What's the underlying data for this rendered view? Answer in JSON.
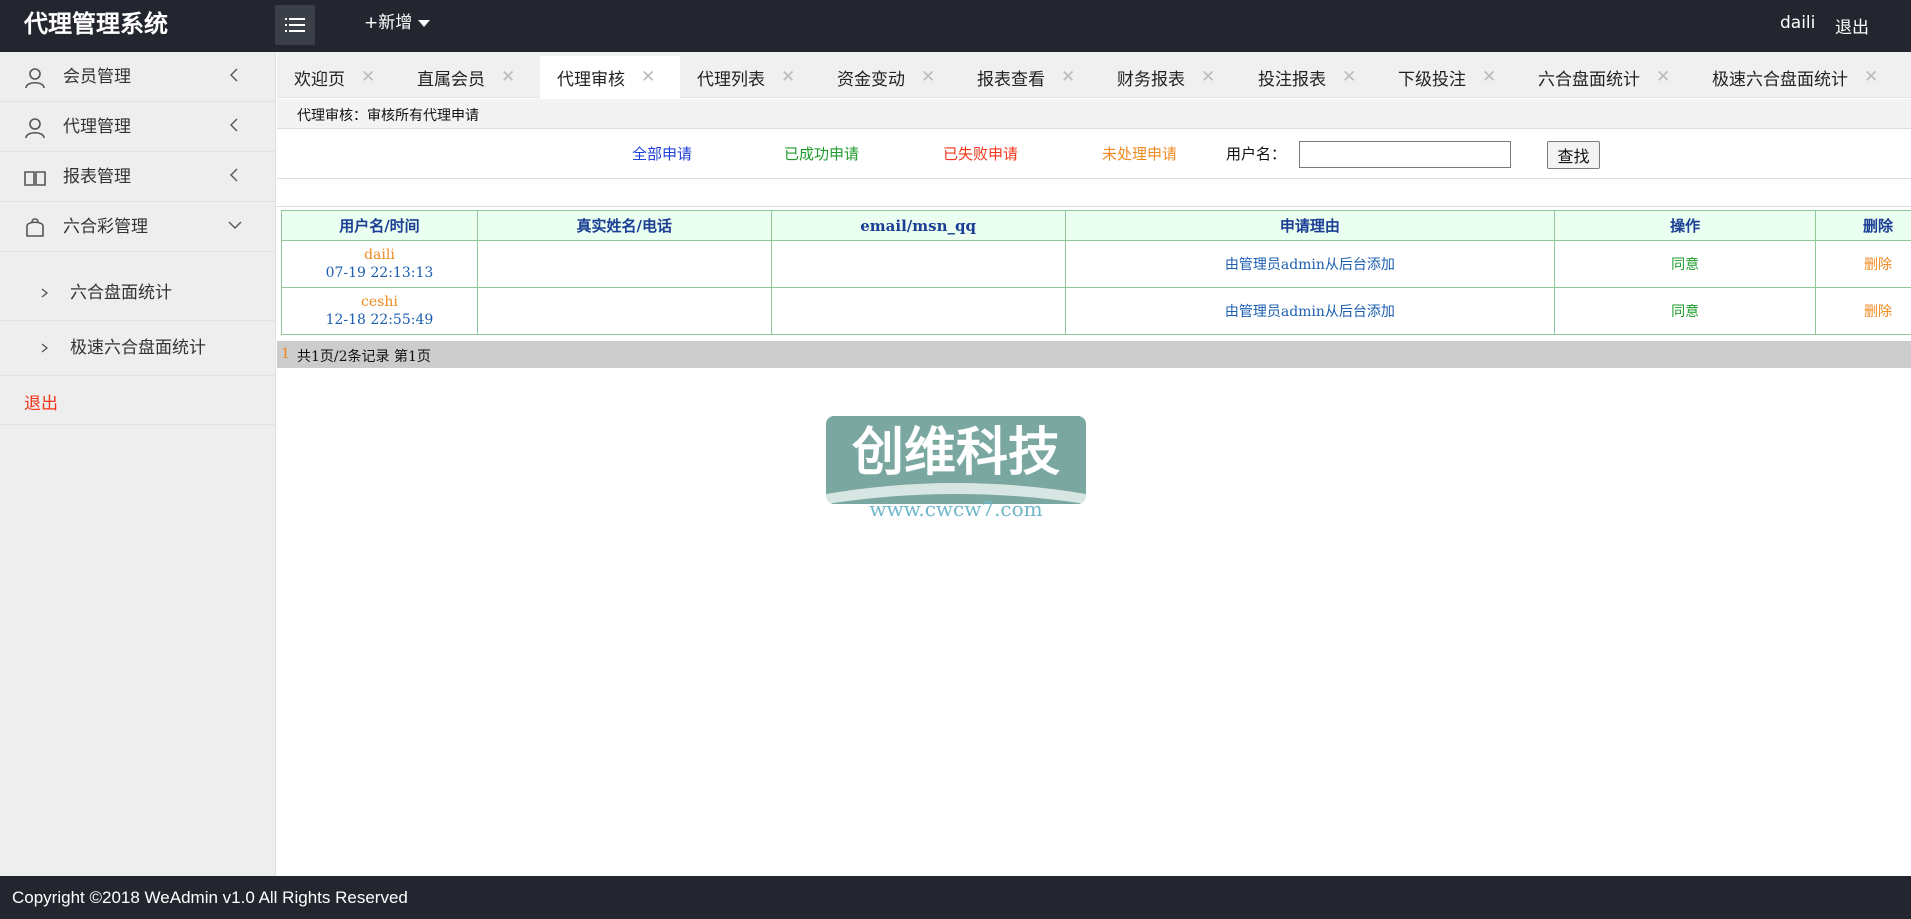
{
  "header": {
    "title": "代理管理系统",
    "add_new": "+新增",
    "user": "daili",
    "logout": "退出"
  },
  "sidebar": {
    "items": [
      {
        "label": "会员管理",
        "icon": "user-icon"
      },
      {
        "label": "代理管理",
        "icon": "user-icon"
      },
      {
        "label": "报表管理",
        "icon": "book-icon"
      },
      {
        "label": "六合彩管理",
        "icon": "bag-icon"
      }
    ],
    "subitems": [
      {
        "label": "六合盘面统计"
      },
      {
        "label": "极速六合盘面统计"
      }
    ],
    "logout": "退出"
  },
  "tabs": [
    {
      "label": "欢迎页"
    },
    {
      "label": "直属会员"
    },
    {
      "label": "代理审核",
      "active": true
    },
    {
      "label": "代理列表"
    },
    {
      "label": "资金变动"
    },
    {
      "label": "报表查看"
    },
    {
      "label": "财务报表"
    },
    {
      "label": "投注报表"
    },
    {
      "label": "下级投注"
    },
    {
      "label": "六合盘面统计"
    },
    {
      "label": "极速六合盘面统计"
    }
  ],
  "breadcrumb": "代理审核：审核所有代理申请",
  "filters": {
    "all": "全部申请",
    "success": "已成功申请",
    "failed": "已失败申请",
    "pending": "未处理申请",
    "username_label": "用户名：",
    "username_value": "",
    "search_button": "查找",
    "colors": {
      "all": "#1f3fd6",
      "success": "#1e9b2d",
      "failed": "#f2361b",
      "pending": "#f08a1f"
    }
  },
  "table": {
    "headers": [
      "用户名/时间",
      "真实姓名/电话",
      "email/msn_qq",
      "申请理由",
      "操作",
      "删除"
    ],
    "rows": [
      {
        "username": "daili",
        "time": "07-19 22:13:13",
        "realname": "",
        "email": "",
        "reason": "由管理员admin从后台添加",
        "action": "同意",
        "delete": "删除"
      },
      {
        "username": "ceshi",
        "time": "12-18 22:55:49",
        "realname": "",
        "email": "",
        "reason": "由管理员admin从后台添加",
        "action": "同意",
        "delete": "删除"
      }
    ]
  },
  "pager": {
    "current": "1",
    "info": "共1页/2条记录 第1页"
  },
  "watermark": {
    "title": "创维科技",
    "url": "www.cwcw7.com"
  },
  "footer": "Copyright ©2018 WeAdmin v1.0 All Rights Reserved"
}
